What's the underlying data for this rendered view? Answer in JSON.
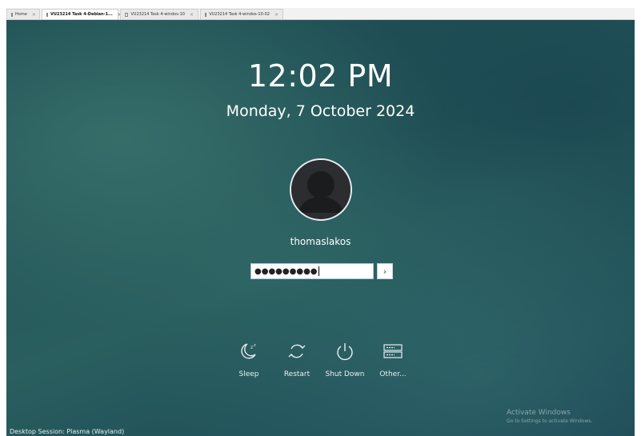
{
  "tabs": [
    {
      "label": "Home",
      "icon": "home-icon",
      "active": false
    },
    {
      "label": "VU23214 Task 4-Debian-1...",
      "icon": "vm-icon",
      "active": true
    },
    {
      "label": "VU23214 Task 4-windos-10",
      "icon": "vm-icon",
      "active": false
    },
    {
      "label": "VU23214 Task 4-windos-10-02",
      "icon": "vm-icon",
      "active": false
    }
  ],
  "lock_screen": {
    "time": "12:02 PM",
    "date": "Monday, 7 October 2024",
    "username": "thomaslakos",
    "password_value": "●●●●●●●●●",
    "submit_icon": "chevron-right-icon"
  },
  "actions": [
    {
      "label": "Sleep",
      "icon": "sleep-icon"
    },
    {
      "label": "Restart",
      "icon": "restart-icon"
    },
    {
      "label": "Shut Down",
      "icon": "power-icon"
    },
    {
      "label": "Other...",
      "icon": "switch-user-icon"
    }
  ],
  "footer": {
    "session": "Desktop Session: Plasma (Wayland)"
  },
  "watermark": {
    "title": "Activate Windows",
    "subtitle": "Go to Settings to activate Windows."
  },
  "colors": {
    "background_top": "#1c4c52",
    "background_mid": "#2a5f5f",
    "text": "#ffffff",
    "field_border": "#a9c7e6"
  }
}
